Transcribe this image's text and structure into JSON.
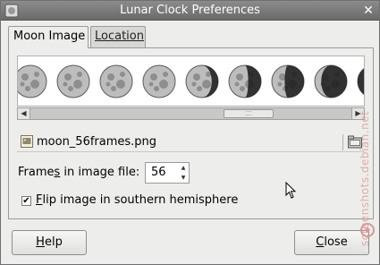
{
  "window": {
    "title": "Lunar Clock Preferences"
  },
  "tabs": [
    {
      "label": "Moon Image",
      "active": true
    },
    {
      "label": "Location",
      "active": false
    }
  ],
  "moon_image": {
    "frames_visible": 9,
    "file_name": "moon_56frames.png",
    "frames_label_pre": "Frame",
    "frames_label_u": "s",
    "frames_label_post": " in image file:",
    "frames_value": "56",
    "flip_checked": true,
    "flip_label_u": "F",
    "flip_label_rest": "lip image in southern hemisphere"
  },
  "buttons": {
    "help_u": "H",
    "help_rest": "elp",
    "close_u": "C",
    "close_rest": "lose"
  },
  "watermark": {
    "text": "screenshots.debian.net"
  },
  "colors": {
    "titlebar": "#7b7b7b",
    "window_bg": "#ededeb",
    "watermark": "#d89898"
  }
}
